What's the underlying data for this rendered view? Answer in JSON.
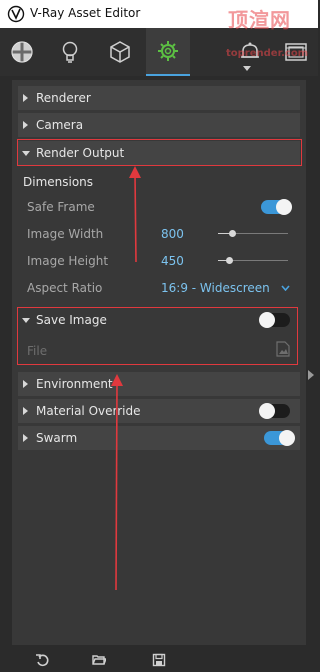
{
  "window": {
    "title": "V-Ray Asset Editor"
  },
  "watermark": {
    "main": "顶渲网",
    "sub": "toprender.com"
  },
  "toolbar": {
    "tools": [
      {
        "name": "materials-icon"
      },
      {
        "name": "lights-icon"
      },
      {
        "name": "geometry-icon"
      },
      {
        "name": "settings-icon",
        "active": true
      },
      {
        "name": "render-elements-icon"
      },
      {
        "name": "textures-icon"
      }
    ]
  },
  "sections": {
    "renderer": "Renderer",
    "camera": "Camera",
    "render_output": "Render Output",
    "environment": "Environment",
    "material_override": "Material Override",
    "swarm": "Swarm"
  },
  "render_output": {
    "dimensions_heading": "Dimensions",
    "safe_frame_label": "Safe Frame",
    "safe_frame_on": true,
    "image_width_label": "Image Width",
    "image_width_value": "800",
    "image_width_slider": 0.2,
    "image_height_label": "Image Height",
    "image_height_value": "450",
    "image_height_slider": 0.15,
    "aspect_ratio_label": "Aspect Ratio",
    "aspect_ratio_value": "16:9 - Widescreen"
  },
  "save_image": {
    "label": "Save Image",
    "enabled": false,
    "file_label": "File"
  },
  "material_override": {
    "enabled": false
  },
  "swarm": {
    "enabled": true
  },
  "colors": {
    "accent": "#3b97d8",
    "value_text": "#7cc3ef",
    "annotation": "#e0393e"
  },
  "bottom_bar": [
    {
      "name": "revert-icon"
    },
    {
      "name": "open-folder-icon"
    },
    {
      "name": "save-icon"
    }
  ]
}
